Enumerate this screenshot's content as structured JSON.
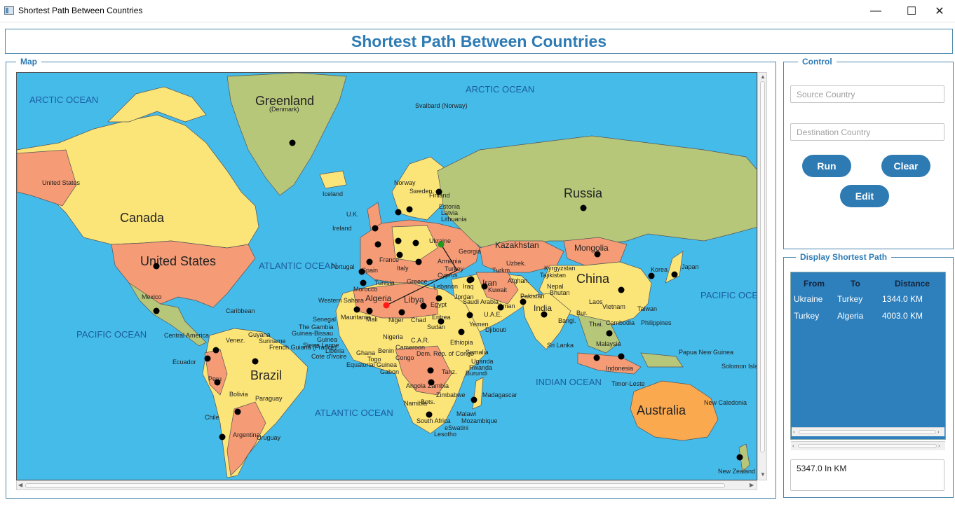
{
  "window": {
    "title": "Shortest Path Between Countries",
    "minimize": "—",
    "maximize": "☐",
    "close": "✕"
  },
  "header": {
    "title": "Shortest Path Between Countries"
  },
  "map_panel": {
    "label": "Map",
    "oceans": [
      "ARCTIC OCEAN",
      "ARCTIC OCEAN",
      "ATLANTIC OCEAN",
      "PACIFIC OCEAN",
      "PACIFIC OCEAN",
      "INDIAN OCEAN",
      "ATLANTIC OCEAN"
    ],
    "countries_big": [
      "Greenland",
      "Canada",
      "United States",
      "Russia",
      "China",
      "Brazil",
      "Australia",
      "Mongolia",
      "Kazakhstan",
      "India",
      "Algeria",
      "Libya",
      "Iran"
    ],
    "countries_small": [
      "(Denmark)",
      "Svalbard (Norway)",
      "Iceland",
      "U.K.",
      "Ireland",
      "Norway",
      "Sweden",
      "Finland",
      "Estonia",
      "Latvia",
      "Lithuania",
      "Portugal",
      "Spain",
      "France",
      "Italy",
      "Ukraine",
      "Turkey",
      "Egypt",
      "Sudan",
      "Mali",
      "Niger",
      "Chad",
      "Nigeria",
      "Ethiopia",
      "Saudi Arabia",
      "Iraq",
      "Japan",
      "Korea",
      "Philippines",
      "Indonesia",
      "Malaysia",
      "Madagascar",
      "Mexico",
      "Caribbean",
      "Guyana",
      "Suriname",
      "French Guiana (France)",
      "Venez.",
      "Ecuador",
      "Peru",
      "Bolivia",
      "Paraguay",
      "Chile",
      "Argentina",
      "Uruguay",
      "Central America",
      "Western Sahara",
      "Senegal",
      "Liberia",
      "Ghana",
      "Gabon",
      "Angola",
      "Zambia",
      "Namibia",
      "Bots.",
      "South Africa",
      "Mozambique",
      "Malawi",
      "Tanz.",
      "Uganda",
      "Rwanda",
      "Burundi",
      "Somalia",
      "Yemen",
      "Djibouti",
      "Eritrea",
      "Pakistan",
      "Afghan.",
      "Nepal",
      "Bhutan",
      "Bangl.",
      "Sri Lanka",
      "Laos",
      "Vietnam",
      "Cambodia",
      "Thai.",
      "Bur.",
      "Taiwan",
      "Kyrgyzstan",
      "Tajikistan",
      "Turkm.",
      "Uzbek.",
      "Georgia",
      "Armenia",
      "Cyprus",
      "Lebanon",
      "Jordan",
      "Kuwait",
      "U.A.E.",
      "Oman",
      "Greece",
      "Tunisia",
      "Morocco",
      "Mauritania",
      "The Gambia",
      "Guinea-Bissau",
      "Guinea",
      "Sierra Leone",
      "Cote d'Ivoire",
      "Togo",
      "Benin",
      "Equatorial Guinea",
      "Cameroon",
      "C.A.R.",
      "Congo",
      "Dem. Rep. of Congo",
      "Zimbabwe",
      "eSwatini",
      "Lesotho",
      "Papua New Guinea",
      "Solomon Islands",
      "New Caledonia",
      "New Zealand",
      "Timor-Leste",
      "United States"
    ],
    "path_colors": {
      "start": "#1d9c1d",
      "end": "#ff1a1a",
      "line": "#111111"
    }
  },
  "control": {
    "label": "Control",
    "source_placeholder": "Source Country",
    "destination_placeholder": "Destination Country",
    "run_label": "Run",
    "clear_label": "Clear",
    "edit_label": "Edit"
  },
  "path_display": {
    "label": "Display Shortest Path",
    "columns": [
      "From",
      "To",
      "Distance"
    ],
    "rows": [
      [
        "Ukraine",
        "Turkey",
        "1344.0 KM"
      ],
      [
        "Turkey",
        "Algeria",
        "4003.0 KM"
      ]
    ],
    "total": "5347.0 In KM"
  },
  "colors": {
    "accent": "#2e7bb4",
    "ocean": "#45bbea",
    "table_bg": "#2e80bd"
  }
}
